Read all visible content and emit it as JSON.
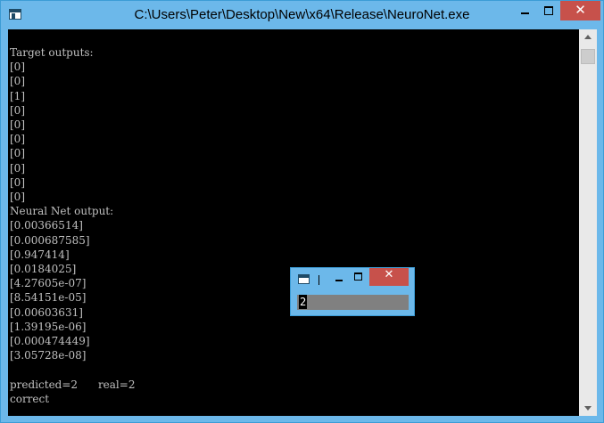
{
  "window": {
    "title": "C:\\Users\\Peter\\Desktop\\New\\x64\\Release\\NeuroNet.exe",
    "close_glyph": "✕"
  },
  "console": {
    "lines": [
      "Target outputs:",
      "[0]",
      "[0]",
      "[1]",
      "[0]",
      "[0]",
      "[0]",
      "[0]",
      "[0]",
      "[0]",
      "[0]",
      "Neural Net output:",
      "[0.00366514]",
      "[0.000687585]",
      "[0.947414]",
      "[0.0184025]",
      "[4.27605e-07]",
      "[8.54151e-05]",
      "[0.00603631]",
      "[1.39195e-06]",
      "[0.000474449]",
      "[3.05728e-08]",
      "",
      "predicted=2      real=2",
      "correct"
    ]
  },
  "popup": {
    "close_glyph": "✕",
    "value": "2"
  },
  "colors": {
    "titlebar": "#6cb8ea",
    "close_button": "#c7514b",
    "console_bg": "#000000",
    "console_text": "#c0c0c0"
  }
}
